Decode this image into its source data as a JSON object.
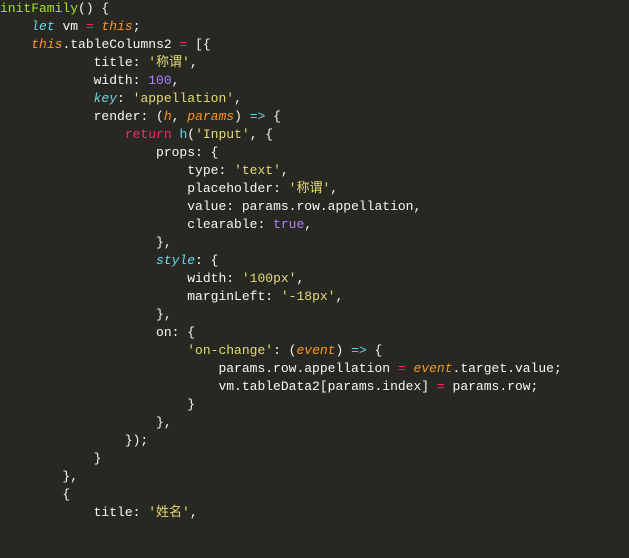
{
  "code": {
    "fn_name": "initFamily",
    "let_kw": "let",
    "vm_var": "vm",
    "this_kw": "this",
    "tableColumns2": "tableColumns2",
    "title_key": "title",
    "title_val1": "'称谓'",
    "width_key": "width",
    "width_val": "100",
    "key_key": "key",
    "key_val": "'appellation'",
    "render_key": "render",
    "h_param": "h",
    "params_param": "params",
    "return_kw": "return",
    "h_call": "h",
    "input_str": "'Input'",
    "props_key": "props",
    "type_key": "type",
    "type_val": "'text'",
    "placeholder_key": "placeholder",
    "placeholder_val": "'称谓'",
    "value_key": "value",
    "params_row_appellation": "params.row.appellation",
    "clearable_key": "clearable",
    "true_val": "true",
    "style_key": "style",
    "style_width_val": "'100px'",
    "marginLeft_key": "marginLeft",
    "marginLeft_val": "'-18px'",
    "on_key": "on",
    "on_change_key": "'on-change'",
    "event_param": "event",
    "event_target_value": ".target.value",
    "tableData2": "tableData2",
    "params_index": "params.index",
    "params_row": "params.row",
    "title_val2": "'姓名'"
  }
}
